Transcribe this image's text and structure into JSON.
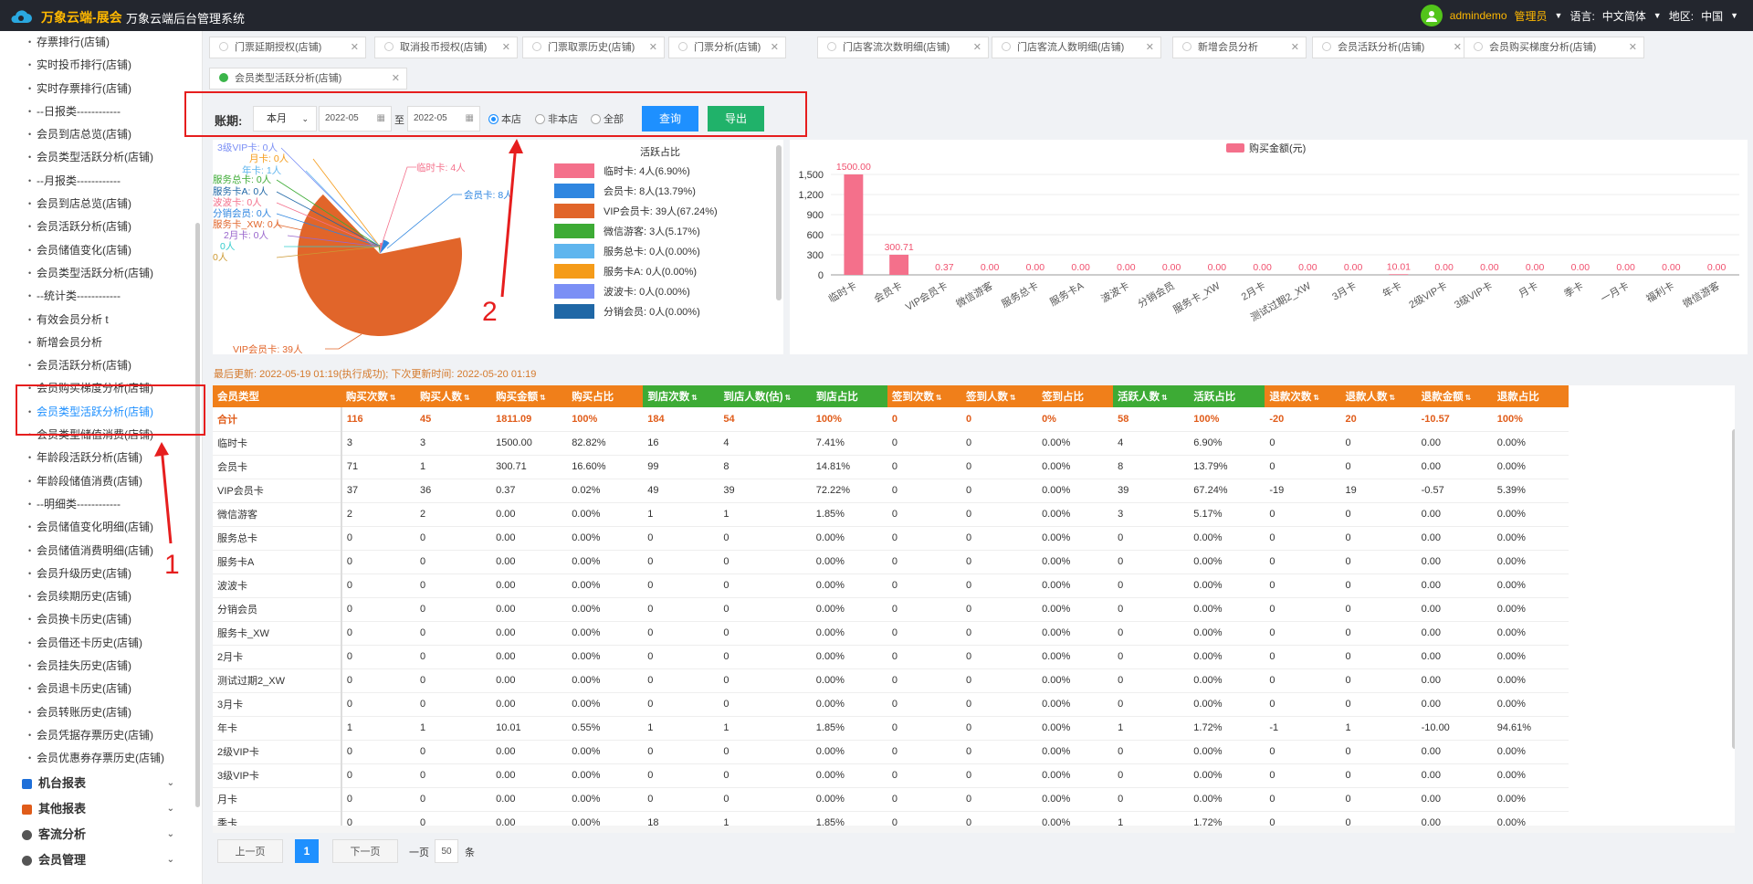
{
  "header": {
    "brand": "万象云端-展会",
    "system_name": "万象云端后台管理系统",
    "user": "admindemo",
    "role": "管理员",
    "lang_label": "语言:",
    "lang_value": "中文简体",
    "region_label": "地区:",
    "region_value": "中国"
  },
  "sidebar": {
    "items": [
      {
        "label": "存票排行(店铺)"
      },
      {
        "label": "实时投币排行(店铺)"
      },
      {
        "label": "实时存票排行(店铺)"
      },
      {
        "label": "--日报类------------"
      },
      {
        "label": "会员到店总览(店铺)"
      },
      {
        "label": "会员类型活跃分析(店铺)"
      },
      {
        "label": "--月报类------------"
      },
      {
        "label": "会员到店总览(店铺)"
      },
      {
        "label": "会员活跃分析(店铺)"
      },
      {
        "label": "会员储值变化(店铺)"
      },
      {
        "label": "会员类型活跃分析(店铺)"
      },
      {
        "label": "--统计类------------"
      },
      {
        "label": "有效会员分析 t"
      },
      {
        "label": "新增会员分析"
      },
      {
        "label": "会员活跃分析(店铺)"
      },
      {
        "label": "会员购买梯度分析(店铺)"
      },
      {
        "label": "会员类型活跃分析(店铺)",
        "active": true
      },
      {
        "label": "会员类型储值消费(店铺)"
      },
      {
        "label": "年龄段活跃分析(店铺)"
      },
      {
        "label": "年龄段储值消费(店铺)"
      },
      {
        "label": "--明细类------------"
      },
      {
        "label": "会员储值变化明细(店铺)"
      },
      {
        "label": "会员储值消费明细(店铺)"
      },
      {
        "label": "会员升级历史(店铺)"
      },
      {
        "label": "会员续期历史(店铺)"
      },
      {
        "label": "会员换卡历史(店铺)"
      },
      {
        "label": "会员借还卡历史(店铺)"
      },
      {
        "label": "会员挂失历史(店铺)"
      },
      {
        "label": "会员退卡历史(店铺)"
      },
      {
        "label": "会员转账历史(店铺)"
      },
      {
        "label": "会员凭据存票历史(店铺)"
      },
      {
        "label": "会员优惠券存票历史(店铺)"
      }
    ],
    "groups": [
      {
        "label": "机台报表",
        "color": "#1e6fd9"
      },
      {
        "label": "其他报表",
        "color": "#e05c1a"
      },
      {
        "label": "客流分析",
        "color": "#555555"
      },
      {
        "label": "会员管理",
        "color": "#555555"
      }
    ]
  },
  "tabs": [
    {
      "label": "门票延期授权(店铺)"
    },
    {
      "label": "取消投币授权(店铺)"
    },
    {
      "label": "门票取票历史(店铺)"
    },
    {
      "label": "门票分析(店铺)"
    },
    {
      "label": "门店客流次数明细(店铺)"
    },
    {
      "label": "门店客流人数明细(店铺)"
    },
    {
      "label": "新增会员分析"
    },
    {
      "label": "会员活跃分析(店铺)"
    },
    {
      "label": "会员购买梯度分析(店铺)"
    },
    {
      "label": "会员类型活跃分析(店铺)",
      "active": true
    }
  ],
  "filter": {
    "label": "账期:",
    "period": "本月",
    "date_from": "2022-05",
    "to_label": "至",
    "date_to": "2022-05",
    "radio_this": "本店",
    "radio_other": "非本店",
    "radio_all": "全部",
    "query": "查询",
    "export": "导出"
  },
  "annotations": {
    "one": "1",
    "two": "2"
  },
  "pie": {
    "legend_title": "活跃占比",
    "legend": [
      {
        "text": "临时卡: 4人(6.90%)",
        "color": "#f4708b"
      },
      {
        "text": "会员卡: 8人(13.79%)",
        "color": "#2f86e0"
      },
      {
        "text": "VIP会员卡: 39人(67.24%)",
        "color": "#e1652a"
      },
      {
        "text": "微信游客: 3人(5.17%)",
        "color": "#3dab35"
      },
      {
        "text": "服务总卡: 0人(0.00%)",
        "color": "#5fb5ee"
      },
      {
        "text": "服务卡A: 0人(0.00%)",
        "color": "#f59b19"
      },
      {
        "text": "波波卡: 0人(0.00%)",
        "color": "#7b8ff5"
      },
      {
        "text": "分销会员: 0人(0.00%)",
        "color": "#1f67a6"
      }
    ],
    "labels": {
      "temp": "临时卡: 4人",
      "member": "会员卡: 8人",
      "vip": "VIP会员卡: 39人",
      "l1": "3级VIP卡: 0人",
      "l2": "月卡: 0人",
      "l3": "年卡: 1人",
      "l4": "服务总卡: 0人",
      "l5": "服务卡A: 0人",
      "l6": "波波卡: 0人",
      "l7": "分销会员: 0人",
      "l8": "服务卡_XW: 0人",
      "l9": "2月卡: 0人",
      "l10": "0人",
      "l11": "0人"
    }
  },
  "chart_data": {
    "type": "bar",
    "title": "",
    "legend": [
      "购买金额(元)"
    ],
    "series": [
      {
        "name": "购买金额(元)",
        "color": "#f4708b",
        "values": [
          1500.0,
          300.71,
          0.37,
          0.0,
          0.0,
          0.0,
          0.0,
          0.0,
          0.0,
          0.0,
          0.0,
          0.0,
          10.01,
          0.0,
          0.0,
          0.0,
          0.0,
          0.0,
          0.0,
          0.0
        ]
      }
    ],
    "categories": [
      "临时卡",
      "会员卡",
      "VIP会员卡",
      "微信游客",
      "服务总卡",
      "服务卡A",
      "波波卡",
      "分销会员",
      "服务卡_XW",
      "2月卡",
      "测试过期2_XW",
      "3月卡",
      "年卡",
      "2级VIP卡",
      "3级VIP卡",
      "月卡",
      "季卡",
      "一月卡",
      "福利卡",
      "微信游客"
    ],
    "value_labels": [
      "1500.00",
      "300.71",
      "0.37",
      "0.00",
      "0.00",
      "0.00",
      "0.00",
      "0.00",
      "0.00",
      "0.00",
      "0.00",
      "0.00",
      "10.01",
      "0.00",
      "0.00",
      "0.00",
      "0.00",
      "0.00",
      "0.00",
      "0.00"
    ],
    "yticks": [
      "0",
      "300",
      "600",
      "900",
      "1,200",
      "1,500"
    ],
    "ylim": [
      0,
      1500
    ]
  },
  "update_text": "最后更新: 2022-05-19 01:19(执行成功); 下次更新时间: 2022-05-20 01:19",
  "table": {
    "columns": [
      {
        "label": "会员类型",
        "color": "#f07f1a",
        "sort": false
      },
      {
        "label": "购买次数",
        "color": "#f07f1a",
        "sort": true
      },
      {
        "label": "购买人数",
        "color": "#f07f1a",
        "sort": true
      },
      {
        "label": "购买金额",
        "color": "#f07f1a",
        "sort": true
      },
      {
        "label": "购买占比",
        "color": "#f07f1a",
        "sort": false
      },
      {
        "label": "到店次数",
        "color": "#3dab35",
        "sort": true
      },
      {
        "label": "到店人数(估)",
        "color": "#3dab35",
        "sort": true
      },
      {
        "label": "到店占比",
        "color": "#3dab35",
        "sort": false
      },
      {
        "label": "签到次数",
        "color": "#f07f1a",
        "sort": true
      },
      {
        "label": "签到人数",
        "color": "#f07f1a",
        "sort": true
      },
      {
        "label": "签到占比",
        "color": "#f07f1a",
        "sort": false
      },
      {
        "label": "活跃人数",
        "color": "#3dab35",
        "sort": true
      },
      {
        "label": "活跃占比",
        "color": "#3dab35",
        "sort": false
      },
      {
        "label": "退款次数",
        "color": "#f07f1a",
        "sort": true
      },
      {
        "label": "退款人数",
        "color": "#f07f1a",
        "sort": true
      },
      {
        "label": "退款金额",
        "color": "#f07f1a",
        "sort": true
      },
      {
        "label": "退款占比",
        "color": "#f07f1a",
        "sort": false
      }
    ],
    "rows": [
      [
        "合计",
        "116",
        "45",
        "1811.09",
        "100%",
        "184",
        "54",
        "100%",
        "0",
        "0",
        "0%",
        "58",
        "100%",
        "-20",
        "20",
        "-10.57",
        "100%"
      ],
      [
        "临时卡",
        "3",
        "3",
        "1500.00",
        "82.82%",
        "16",
        "4",
        "7.41%",
        "0",
        "0",
        "0.00%",
        "4",
        "6.90%",
        "0",
        "0",
        "0.00",
        "0.00%"
      ],
      [
        "会员卡",
        "71",
        "1",
        "300.71",
        "16.60%",
        "99",
        "8",
        "14.81%",
        "0",
        "0",
        "0.00%",
        "8",
        "13.79%",
        "0",
        "0",
        "0.00",
        "0.00%"
      ],
      [
        "VIP会员卡",
        "37",
        "36",
        "0.37",
        "0.02%",
        "49",
        "39",
        "72.22%",
        "0",
        "0",
        "0.00%",
        "39",
        "67.24%",
        "-19",
        "19",
        "-0.57",
        "5.39%"
      ],
      [
        "微信游客",
        "2",
        "2",
        "0.00",
        "0.00%",
        "1",
        "1",
        "1.85%",
        "0",
        "0",
        "0.00%",
        "3",
        "5.17%",
        "0",
        "0",
        "0.00",
        "0.00%"
      ],
      [
        "服务总卡",
        "0",
        "0",
        "0.00",
        "0.00%",
        "0",
        "0",
        "0.00%",
        "0",
        "0",
        "0.00%",
        "0",
        "0.00%",
        "0",
        "0",
        "0.00",
        "0.00%"
      ],
      [
        "服务卡A",
        "0",
        "0",
        "0.00",
        "0.00%",
        "0",
        "0",
        "0.00%",
        "0",
        "0",
        "0.00%",
        "0",
        "0.00%",
        "0",
        "0",
        "0.00",
        "0.00%"
      ],
      [
        "波波卡",
        "0",
        "0",
        "0.00",
        "0.00%",
        "0",
        "0",
        "0.00%",
        "0",
        "0",
        "0.00%",
        "0",
        "0.00%",
        "0",
        "0",
        "0.00",
        "0.00%"
      ],
      [
        "分销会员",
        "0",
        "0",
        "0.00",
        "0.00%",
        "0",
        "0",
        "0.00%",
        "0",
        "0",
        "0.00%",
        "0",
        "0.00%",
        "0",
        "0",
        "0.00",
        "0.00%"
      ],
      [
        "服务卡_XW",
        "0",
        "0",
        "0.00",
        "0.00%",
        "0",
        "0",
        "0.00%",
        "0",
        "0",
        "0.00%",
        "0",
        "0.00%",
        "0",
        "0",
        "0.00",
        "0.00%"
      ],
      [
        "2月卡",
        "0",
        "0",
        "0.00",
        "0.00%",
        "0",
        "0",
        "0.00%",
        "0",
        "0",
        "0.00%",
        "0",
        "0.00%",
        "0",
        "0",
        "0.00",
        "0.00%"
      ],
      [
        "测试过期2_XW",
        "0",
        "0",
        "0.00",
        "0.00%",
        "0",
        "0",
        "0.00%",
        "0",
        "0",
        "0.00%",
        "0",
        "0.00%",
        "0",
        "0",
        "0.00",
        "0.00%"
      ],
      [
        "3月卡",
        "0",
        "0",
        "0.00",
        "0.00%",
        "0",
        "0",
        "0.00%",
        "0",
        "0",
        "0.00%",
        "0",
        "0.00%",
        "0",
        "0",
        "0.00",
        "0.00%"
      ],
      [
        "年卡",
        "1",
        "1",
        "10.01",
        "0.55%",
        "1",
        "1",
        "1.85%",
        "0",
        "0",
        "0.00%",
        "1",
        "1.72%",
        "-1",
        "1",
        "-10.00",
        "94.61%"
      ],
      [
        "2级VIP卡",
        "0",
        "0",
        "0.00",
        "0.00%",
        "0",
        "0",
        "0.00%",
        "0",
        "0",
        "0.00%",
        "0",
        "0.00%",
        "0",
        "0",
        "0.00",
        "0.00%"
      ],
      [
        "3级VIP卡",
        "0",
        "0",
        "0.00",
        "0.00%",
        "0",
        "0",
        "0.00%",
        "0",
        "0",
        "0.00%",
        "0",
        "0.00%",
        "0",
        "0",
        "0.00",
        "0.00%"
      ],
      [
        "月卡",
        "0",
        "0",
        "0.00",
        "0.00%",
        "0",
        "0",
        "0.00%",
        "0",
        "0",
        "0.00%",
        "0",
        "0.00%",
        "0",
        "0",
        "0.00",
        "0.00%"
      ],
      [
        "季卡",
        "0",
        "0",
        "0.00",
        "0.00%",
        "18",
        "1",
        "1.85%",
        "0",
        "0",
        "0.00%",
        "1",
        "1.72%",
        "0",
        "0",
        "0.00",
        "0.00%"
      ]
    ]
  },
  "pager": {
    "prev": "上一页",
    "page": "1",
    "next": "下一页",
    "per_page_label": "一页",
    "per_page": "50",
    "unit": "条"
  }
}
